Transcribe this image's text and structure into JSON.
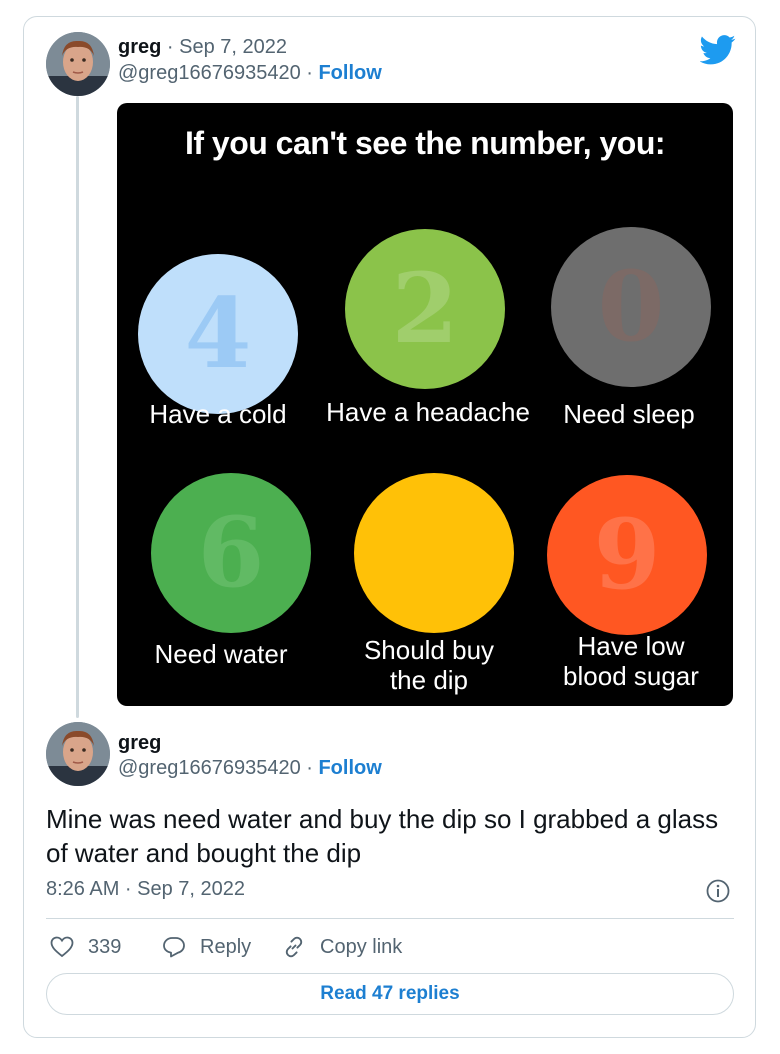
{
  "tweet1": {
    "name": "greg",
    "date": "Sep 7, 2022",
    "handle": "@greg16676935420",
    "follow": "Follow"
  },
  "meme": {
    "title": "If you can't see the number, you:",
    "circles": [
      {
        "number": "4",
        "caption": "Have a cold",
        "color": "#bfdffb",
        "num_color": "#9ccaf5"
      },
      {
        "number": "2",
        "caption": "Have a headache",
        "color": "#8bc34a",
        "num_color": "#a0ce6c"
      },
      {
        "number": "0",
        "caption": "Need sleep",
        "color": "#6e6e6e",
        "num_color": "#7c6a66"
      },
      {
        "number": "6",
        "caption": "Need water",
        "color": "#4caf50",
        "num_color": "#61ba64"
      },
      {
        "number": "",
        "caption": "Should buy the dip",
        "color": "#ffc107",
        "num_color": "#ffc107"
      },
      {
        "number": "9",
        "caption": "Have low blood sugar",
        "color": "#ff5722",
        "num_color": "#ff7248"
      }
    ]
  },
  "tweet2": {
    "name": "greg",
    "handle": "@greg16676935420",
    "follow": "Follow",
    "text": "Mine was need water and buy the dip so I grabbed a glass of water and bought the dip",
    "timestamp": "8:26 AM · Sep 7, 2022"
  },
  "actions": {
    "likes": "339",
    "reply": "Reply",
    "copy_link": "Copy link",
    "read_replies": "Read 47 replies"
  },
  "colors": {
    "accent": "#1d9bf0",
    "link": "#1d7fd1",
    "muted": "#536471"
  },
  "icons": [
    "twitter-bird-icon",
    "info-icon",
    "heart-icon",
    "reply-icon",
    "link-icon"
  ]
}
